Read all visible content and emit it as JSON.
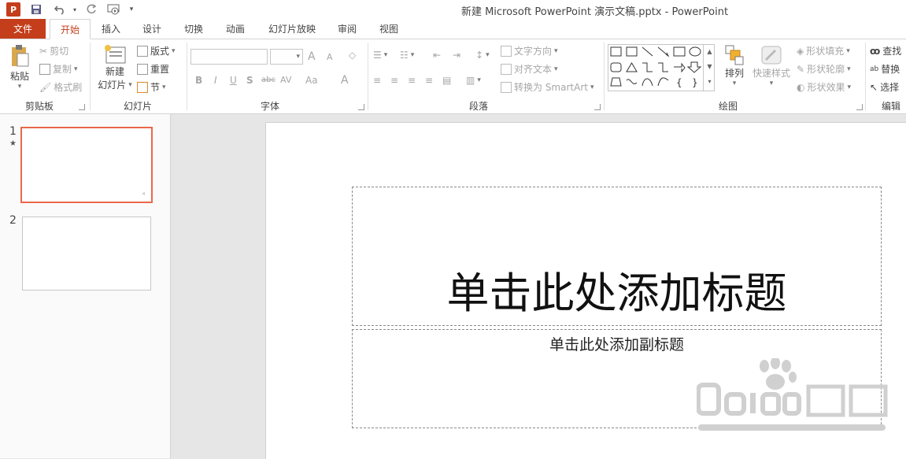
{
  "app": {
    "icon_letter": "P",
    "window_title": "新建 Microsoft PowerPoint 演示文稿.pptx - PowerPoint"
  },
  "quick_access": {
    "save": "save-icon",
    "undo": "undo-icon",
    "redo": "redo-icon",
    "start": "start-from-beginning-icon",
    "customize": "customize-icon"
  },
  "tabs": {
    "file": "文件",
    "items": [
      {
        "label": "开始",
        "active": true
      },
      {
        "label": "插入"
      },
      {
        "label": "设计"
      },
      {
        "label": "切换"
      },
      {
        "label": "动画"
      },
      {
        "label": "幻灯片放映"
      },
      {
        "label": "审阅"
      },
      {
        "label": "视图"
      }
    ]
  },
  "ribbon": {
    "clipboard": {
      "paste": "粘贴",
      "cut": "剪切",
      "copy": "复制",
      "format_painter": "格式刷",
      "label": "剪贴板"
    },
    "slides": {
      "new_slide_line1": "新建",
      "new_slide_line2": "幻灯片",
      "layout": "版式",
      "reset": "重置",
      "section": "节",
      "label": "幻灯片"
    },
    "font": {
      "bold": "B",
      "italic": "I",
      "underline": "U",
      "shadow": "S",
      "strike": "abc",
      "spacing": "AV",
      "case": "Aa",
      "grow": "A",
      "shrink": "A",
      "color": "A",
      "label": "字体"
    },
    "paragraph": {
      "text_direction": "文字方向",
      "align_text": "对齐文本",
      "smartart": "转换为 SmartArt",
      "label": "段落"
    },
    "drawing": {
      "arrange": "排列",
      "quick_styles": "快速样式",
      "shape_fill": "形状填充",
      "shape_outline": "形状轮廓",
      "shape_effects": "形状效果",
      "label": "绘图"
    },
    "editing": {
      "find": "查找",
      "replace": "替换",
      "select": "选择",
      "label": "编辑"
    }
  },
  "slides": [
    {
      "number": "1",
      "selected": true
    },
    {
      "number": "2",
      "selected": false
    }
  ],
  "slide": {
    "title_placeholder": "单击此处添加标题",
    "subtitle_placeholder": "单击此处添加副标题"
  },
  "colors": {
    "accent": "#c43e1c",
    "selection": "#e8684a"
  }
}
